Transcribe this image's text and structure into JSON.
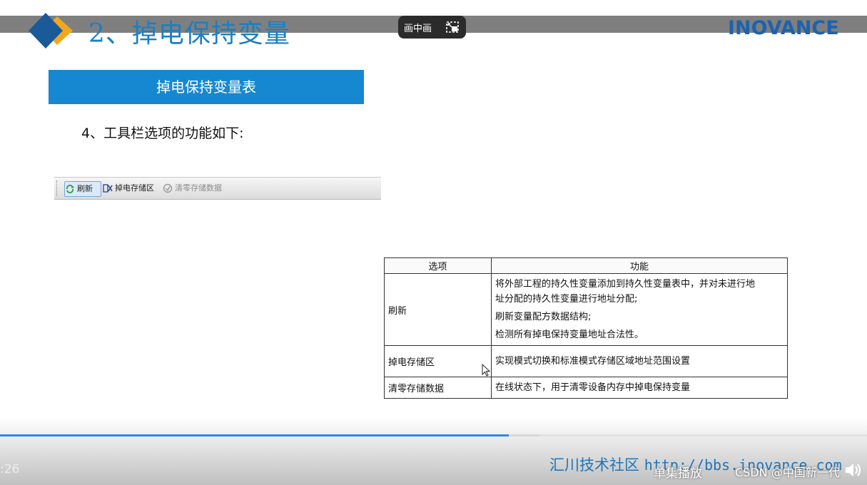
{
  "slide": {
    "title": "2、掉电保持变量",
    "brand": "INOVANCE",
    "banner": "掉电保持变量表",
    "step": "4、工具栏选项的功能如下:"
  },
  "pip": {
    "label": "画中画",
    "icon": "picture-in-picture-icon"
  },
  "toolbar": {
    "refresh": "刷新",
    "power_down_area": "掉电存储区",
    "clear_data": "清零存储数据"
  },
  "table": {
    "headers": [
      "选项",
      "功能"
    ],
    "rows": [
      {
        "option": "刷新",
        "lines": [
          "将外部工程的持久性变量添加到持久性变量表中，并对未进行地",
          "址分配的持久性变量进行地址分配;",
          "刷新变量配方数据结构;",
          "检测所有掉电保持变量地址合法性。"
        ]
      },
      {
        "option": "掉电存储区",
        "lines": [
          "实现模式切换和标准模式存储区域地址范围设置"
        ]
      },
      {
        "option": "清零存储数据",
        "lines": [
          "在线状态下，用于清零设备内存中掉电保持变量"
        ]
      }
    ]
  },
  "player": {
    "time": ":26",
    "progress_fraction": 0.587,
    "buffer_fraction": 0.622,
    "footer_text": "汇川技术社区",
    "footer_url": "http://bbs.inovance.com",
    "loop_label": "单集播放",
    "watermark": "CSDN @中国新一代",
    "colors": {
      "accent": "#2b8be6",
      "title": "#1a7fc4",
      "banner": "#1588d1"
    }
  }
}
